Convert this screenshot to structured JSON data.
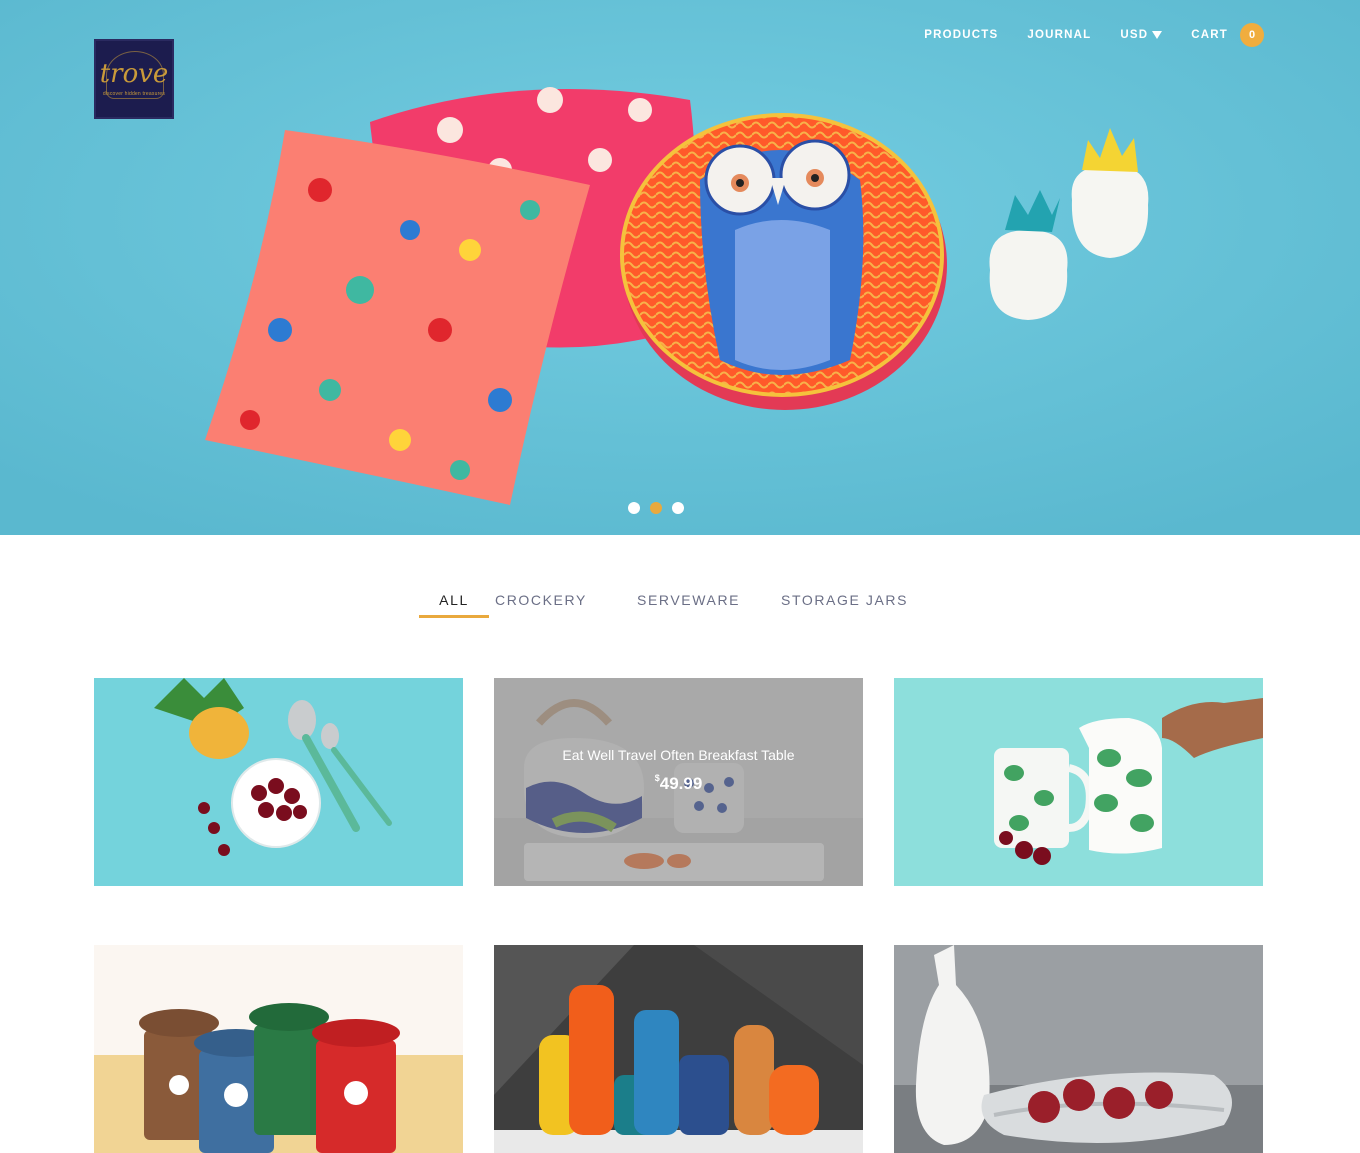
{
  "brand": {
    "logo_text": "trove",
    "tagline": "discover hidden treasures"
  },
  "nav": {
    "products": "PRODUCTS",
    "journal": "JOURNAL",
    "currency": "USD",
    "cart_label": "CART",
    "cart_count": "0"
  },
  "slider": {
    "slide_count": 3,
    "active_index": 1
  },
  "tabs": [
    {
      "label": "ALL",
      "active": true
    },
    {
      "label": "CROCKERY",
      "active": false
    },
    {
      "label": "SERVEWARE",
      "active": false
    },
    {
      "label": "STORAGE JARS",
      "active": false
    }
  ],
  "products": [
    {
      "image": "cherries-and-spoons-on-turquoise"
    },
    {
      "image": "teapot-and-sushi-platter",
      "hover_title": "Eat Well Travel Often Breakfast Table",
      "currency_symbol": "$",
      "price": "49.99"
    },
    {
      "image": "monstera-leaf-jug-and-mug"
    },
    {
      "image": "animal-lidded-mugs"
    },
    {
      "image": "colorful-bottles-and-vases"
    },
    {
      "image": "white-vase-and-silver-bowl"
    }
  ],
  "colors": {
    "hero_bg": "#6cc6db",
    "accent": "#e9a93d",
    "logo_bg": "#1c1c4e",
    "tab_text": "#6b6f86"
  }
}
